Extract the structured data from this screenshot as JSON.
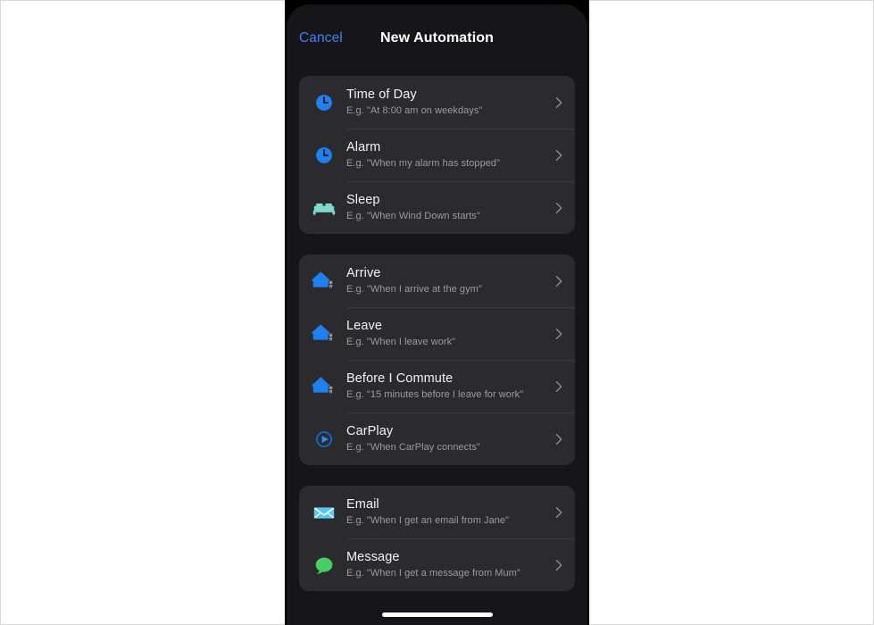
{
  "nav": {
    "cancel_label": "Cancel",
    "title": "New Automation"
  },
  "colors": {
    "accent_blue": "#3c82f6",
    "icon_blue": "#1f80ef",
    "icon_mint": "#7fd9cd",
    "icon_green": "#45d062",
    "icon_envelope": "#5ac8f5",
    "card_bg": "#2b2b2d",
    "screen_bg": "#161618",
    "title_text": "#f2f2f4",
    "subtitle_text": "#9b9b9f",
    "chevron": "#8a8a8e"
  },
  "sections": [
    {
      "name": "time-section",
      "rows": [
        {
          "icon": "clock-icon",
          "title": "Time of Day",
          "subtitle": "E.g. \"At 8:00 am on weekdays\"",
          "chevron": "chevron-right-icon"
        },
        {
          "icon": "alarm-clock-icon",
          "title": "Alarm",
          "subtitle": "E.g. \"When my alarm has stopped\"",
          "chevron": "chevron-right-icon"
        },
        {
          "icon": "bed-icon",
          "title": "Sleep",
          "subtitle": "E.g. \"When Wind Down starts\"",
          "chevron": "chevron-right-icon"
        }
      ]
    },
    {
      "name": "location-section",
      "rows": [
        {
          "icon": "house-arrive-icon",
          "title": "Arrive",
          "subtitle": "E.g. \"When I arrive at the gym\"",
          "chevron": "chevron-right-icon"
        },
        {
          "icon": "house-leave-icon",
          "title": "Leave",
          "subtitle": "E.g. \"When I leave work\"",
          "chevron": "chevron-right-icon"
        },
        {
          "icon": "house-commute-icon",
          "title": "Before I Commute",
          "subtitle": "E.g. \"15 minutes before I leave for work\"",
          "chevron": "chevron-right-icon"
        },
        {
          "icon": "carplay-icon",
          "title": "CarPlay",
          "subtitle": "E.g. \"When CarPlay connects\"",
          "chevron": "chevron-right-icon"
        }
      ]
    },
    {
      "name": "communication-section",
      "rows": [
        {
          "icon": "envelope-icon",
          "title": "Email",
          "subtitle": "E.g. \"When I get an email from Jane\"",
          "chevron": "chevron-right-icon"
        },
        {
          "icon": "message-bubble-icon",
          "title": "Message",
          "subtitle": "E.g. \"When I get a message from Mum\"",
          "chevron": "chevron-right-icon"
        }
      ]
    }
  ]
}
